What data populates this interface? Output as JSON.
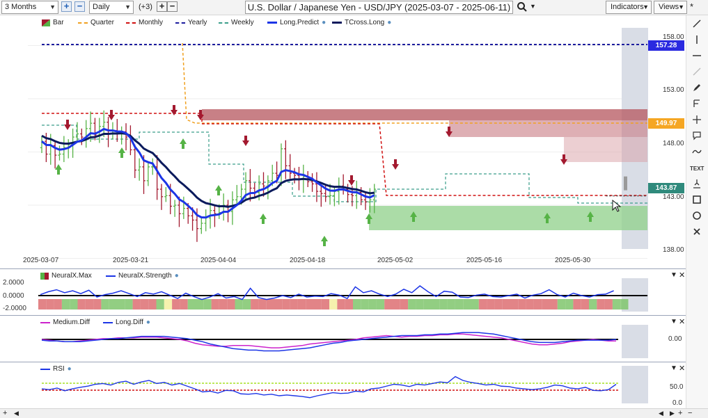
{
  "toolbar": {
    "period": "3 Months",
    "interval": "Daily",
    "overlay_count": "(+3)",
    "title": "U.S. Dollar / Japanese Yen - USD/JPY (2025-03-07 - 2025-06-11)",
    "indicators_label": "Indicators",
    "views_label": "Views",
    "star": "*"
  },
  "legend": {
    "bar": "Bar",
    "quarter": "Quarter",
    "monthly": "Monthly",
    "yearly": "Yearly",
    "weekly": "Weekly",
    "long_predict": "Long.Predict",
    "tcross_long": "TCross.Long"
  },
  "price_axis": [
    "158.00",
    "153.00",
    "148.00",
    "143.00",
    "138.00"
  ],
  "price_tags": {
    "yearly": "157.28",
    "quarter": "149.97",
    "current": "143.87"
  },
  "date_axis": [
    "2025-03-07",
    "2025-03-21",
    "2025-04-04",
    "2025-04-18",
    "2025-05-02",
    "2025-05-16",
    "2025-05-30"
  ],
  "neuralx": {
    "legend_max": "NeuralX.Max",
    "legend_strength": "NeuralX.Strength",
    "axis": [
      "2.0000",
      "0.0000",
      "-2.0000"
    ]
  },
  "diff": {
    "legend_medium": "Medium.Diff",
    "legend_long": "Long.Diff",
    "axis": [
      "0.00"
    ]
  },
  "rsi": {
    "legend": "RSI",
    "axis": [
      "50.0",
      "0.0"
    ]
  },
  "colors": {
    "up": "#56b346",
    "down": "#a3192f",
    "blue_line": "#1c35e6",
    "navy_line": "#0a1a5c",
    "yearly": "#1c1c9e",
    "quarter": "#f0a020",
    "monthly": "#d01010",
    "weekly": "#3a9e8a"
  }
}
